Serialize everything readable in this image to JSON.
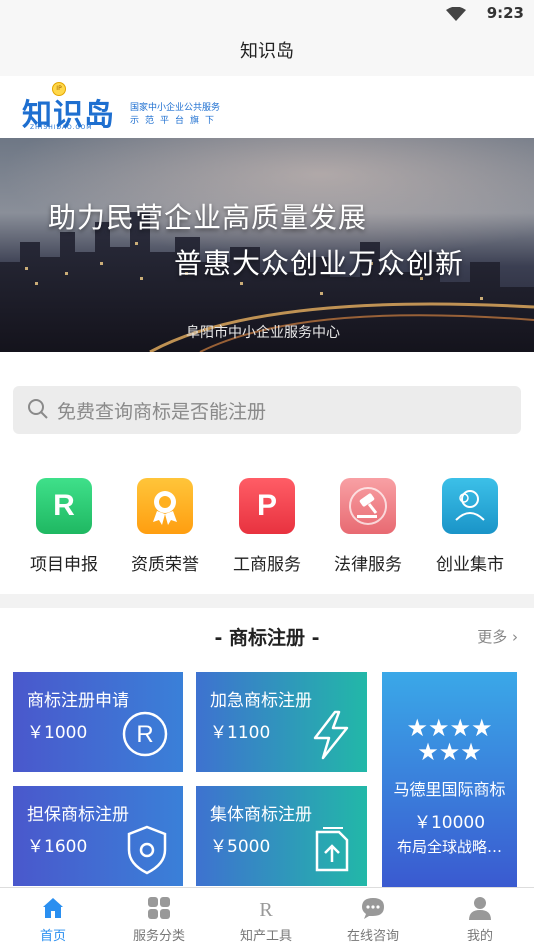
{
  "status_bar": {
    "time": "9:23"
  },
  "title_bar": {
    "title": "知识岛"
  },
  "logo": {
    "name": "知识岛",
    "domain": "ZHISHIDAO.COM",
    "bulb_text": "IP",
    "tagline_1": "国家中小企业公共服务",
    "tagline_2": "示范平台旗下"
  },
  "banner": {
    "line1": "助力民营企业高质量发展",
    "line2": "普惠大众创业万众创新",
    "footer": "阜阳市中小企业服务中心"
  },
  "search": {
    "placeholder": "免费查询商标是否能注册"
  },
  "categories": [
    {
      "label": "项目申报",
      "icon": "r-icon",
      "glyph": "R",
      "color": "#2fcc74"
    },
    {
      "label": "资质荣誉",
      "icon": "award-icon",
      "glyph": "",
      "color": "#ffb020"
    },
    {
      "label": "工商服务",
      "icon": "p-icon",
      "glyph": "P",
      "color": "#f24a55"
    },
    {
      "label": "法律服务",
      "icon": "gavel-icon",
      "glyph": "",
      "color": "#f07f85"
    },
    {
      "label": "创业集市",
      "icon": "person-icon",
      "glyph": "",
      "color": "#2aa8d8"
    }
  ],
  "trademark": {
    "title": "- 商标注册 -",
    "more": "更多",
    "cards": [
      {
        "name": "商标注册申请",
        "price": "￥1000",
        "icon": "registered-icon"
      },
      {
        "name": "加急商标注册",
        "price": "￥1100",
        "icon": "lightning-icon"
      },
      {
        "name": "担保商标注册",
        "price": "￥1600",
        "icon": "shield-icon"
      },
      {
        "name": "集体商标注册",
        "price": "￥5000",
        "icon": "document-upload-icon"
      }
    ],
    "feature": {
      "stars": "★★★★",
      "stars2": "★★★",
      "name": "马德里国际商标",
      "price": "￥10000",
      "desc": "布局全球战略…"
    }
  },
  "tabbar": [
    {
      "label": "首页",
      "icon": "home-icon",
      "active": true
    },
    {
      "label": "服务分类",
      "icon": "grid-icon",
      "active": false
    },
    {
      "label": "知产工具",
      "icon": "r-tool-icon",
      "active": false
    },
    {
      "label": "在线咨询",
      "icon": "chat-icon",
      "active": false
    },
    {
      "label": "我的",
      "icon": "user-icon",
      "active": false
    }
  ],
  "colors": {
    "accent": "#2a8ff0",
    "logo_blue": "#1e6fd0"
  }
}
